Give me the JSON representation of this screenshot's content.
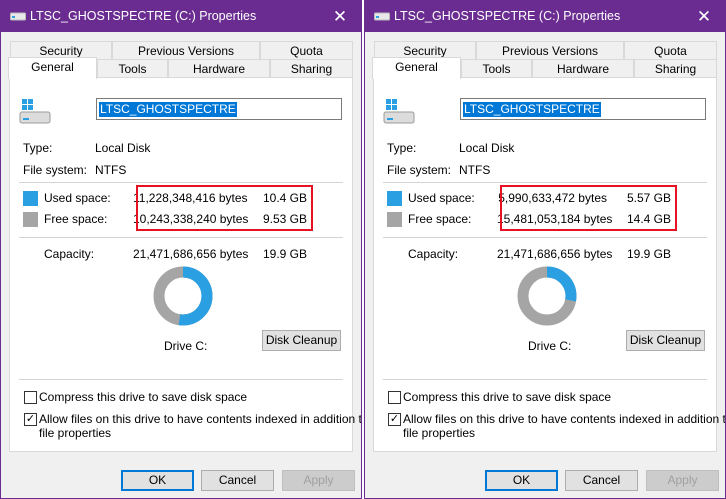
{
  "dialogs": [
    {
      "title": "LTSC_GHOSTSPECTRE (C:) Properties",
      "tabs_row1": [
        "Security",
        "Previous Versions",
        "Quota"
      ],
      "tabs_row2": [
        "General",
        "Tools",
        "Hardware",
        "Sharing"
      ],
      "selected_tab": "General",
      "volume_name": "LTSC_GHOSTSPECTRE",
      "type_label": "Type:",
      "type_value": "Local Disk",
      "fs_label": "File system:",
      "fs_value": "NTFS",
      "used_label": "Used space:",
      "used_bytes": "11,228,348,416 bytes",
      "used_gb": "10.4 GB",
      "free_label": "Free space:",
      "free_bytes": "10,243,338,240 bytes",
      "free_gb": "9.53 GB",
      "capacity_label": "Capacity:",
      "capacity_bytes": "21,471,686,656 bytes",
      "capacity_gb": "19.9 GB",
      "used_fraction": 0.523,
      "drive_label": "Drive C:",
      "cleanup_label": "Disk Cleanup",
      "compress_label": "Compress this drive to save disk space",
      "compress_checked": false,
      "index_label_1": "Allow files on this drive to have contents indexed in addition to",
      "index_label_2": "file properties",
      "index_checked": true,
      "ok_label": "OK",
      "cancel_label": "Cancel",
      "apply_label": "Apply"
    },
    {
      "title": "LTSC_GHOSTSPECTRE (C:) Properties",
      "tabs_row1": [
        "Security",
        "Previous Versions",
        "Quota"
      ],
      "tabs_row2": [
        "General",
        "Tools",
        "Hardware",
        "Sharing"
      ],
      "selected_tab": "General",
      "volume_name": "LTSC_GHOSTSPECTRE",
      "type_label": "Type:",
      "type_value": "Local Disk",
      "fs_label": "File system:",
      "fs_value": "NTFS",
      "used_label": "Used space:",
      "used_bytes": "5,990,633,472 bytes",
      "used_gb": "5.57 GB",
      "free_label": "Free space:",
      "free_bytes": "15,481,053,184 bytes",
      "free_gb": "14.4 GB",
      "capacity_label": "Capacity:",
      "capacity_bytes": "21,471,686,656 bytes",
      "capacity_gb": "19.9 GB",
      "used_fraction": 0.279,
      "drive_label": "Drive C:",
      "cleanup_label": "Disk Cleanup",
      "compress_label": "Compress this drive to save disk space",
      "compress_checked": false,
      "index_label_1": "Allow files on this drive to have contents indexed in addition to",
      "index_label_2": "file properties",
      "index_checked": true,
      "ok_label": "OK",
      "cancel_label": "Cancel",
      "apply_label": "Apply"
    }
  ],
  "colors": {
    "titlebar": "#6a2c91",
    "used": "#2a9fe2",
    "free": "#a5a5a5",
    "highlight_box": "#e81123",
    "selection": "#0078d7"
  },
  "icons": {
    "title": "drive-icon",
    "close": "close-icon",
    "drive": "windows-drive-icon",
    "check": "checkmark-icon"
  }
}
